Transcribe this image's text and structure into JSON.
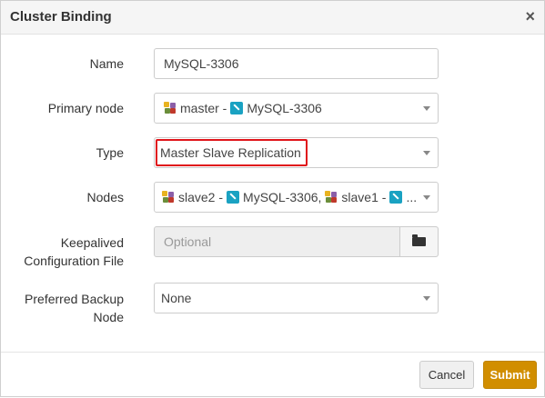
{
  "dialog": {
    "title": "Cluster Binding",
    "close": "×"
  },
  "form": {
    "name": {
      "label": "Name",
      "value": "MySQL-3306"
    },
    "primary_node": {
      "label": "Primary node",
      "node": "master - ",
      "db": "MySQL-3306"
    },
    "type": {
      "label": "Type",
      "value": "Master Slave Replication"
    },
    "nodes": {
      "label": "Nodes",
      "node1": "slave2 - ",
      "db1": "MySQL-3306,",
      "node2": "slave1 - ",
      "ellipsis": "..."
    },
    "keepalived": {
      "label_line1": "Keepalived",
      "label_line2": "Configuration File",
      "placeholder": "Optional"
    },
    "backup_node": {
      "label_line1": "Preferred Backup",
      "label_line2": "Node",
      "value": "None"
    }
  },
  "footer": {
    "cancel_label": "Cancel",
    "submit_label": "Submit"
  },
  "colors": {
    "highlight": "#e0141a",
    "submit": "#d18e00",
    "mysql_icon": "#1aa2c2"
  },
  "icons": [
    "close-icon",
    "node-icon",
    "mysql-icon",
    "chevron-down-icon",
    "folder-open-icon"
  ]
}
